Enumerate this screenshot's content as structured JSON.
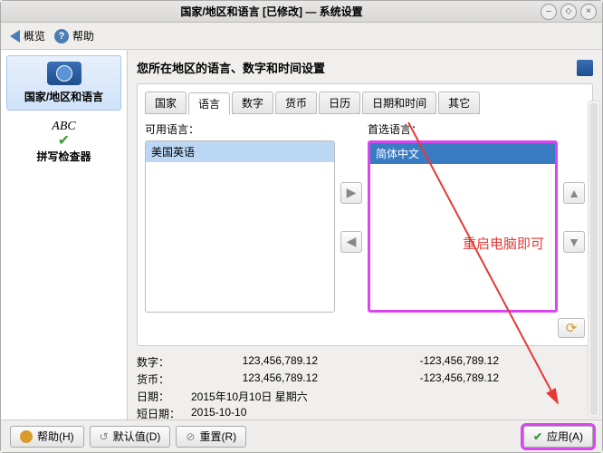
{
  "window": {
    "title": "国家/地区和语言 [已修改] — 系统设置"
  },
  "toolbar": {
    "overview": "概览",
    "help": "帮助"
  },
  "sidebar": {
    "items": [
      {
        "label": "国家/地区和语言"
      },
      {
        "abc": "ABC",
        "label": "拼写检查器"
      }
    ]
  },
  "content": {
    "title": "您所在地区的语言、数字和时间设置",
    "tabs": [
      "国家",
      "语言",
      "数字",
      "货币",
      "日历",
      "日期和时间",
      "其它"
    ],
    "active_tab": 1,
    "available_label": "可用语言：",
    "preferred_label": "首选语言：",
    "available": [
      "美国英语"
    ],
    "preferred": [
      "简体中文"
    ],
    "annotation": "重启电脑即可",
    "examples": {
      "rows": [
        {
          "label": "数字：",
          "v1": "123,456,789.12",
          "v2": "-123,456,789.12"
        },
        {
          "label": "货币：",
          "v1": "123,456,789.12",
          "v2": "-123,456,789.12"
        },
        {
          "label": "日期：",
          "v1": "2015年10月10日 星期六",
          "v2": ""
        },
        {
          "label": "短日期：",
          "v1": "2015-10-10",
          "v2": ""
        }
      ]
    }
  },
  "footer": {
    "help": "帮助(H)",
    "defaults": "默认值(D)",
    "reset": "重置(R)",
    "apply": "应用(A)"
  }
}
